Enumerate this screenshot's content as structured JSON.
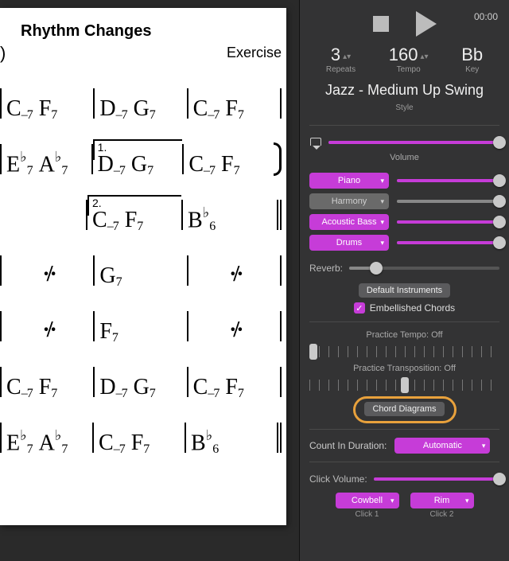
{
  "chart": {
    "title": "Rhythm Changes",
    "subtitle": "Exercise",
    "rows": [
      [
        [
          "C–7",
          "F7"
        ],
        [
          "D–7",
          "G7"
        ],
        [
          "C–7",
          "F7"
        ]
      ],
      [
        [
          "E♭7",
          "A♭7"
        ],
        [
          "D–7",
          "G7",
          "v1"
        ],
        [
          "C–7",
          "F7"
        ]
      ],
      [
        null,
        [
          "C–7",
          "F7",
          "v2"
        ],
        [
          "B♭6"
        ]
      ],
      [
        [
          "%"
        ],
        [
          "G7"
        ],
        [
          "%"
        ]
      ],
      [
        [
          "%"
        ],
        [
          "F7"
        ],
        [
          "%"
        ]
      ],
      [
        [
          "C–7",
          "F7"
        ],
        [
          "D–7",
          "G7"
        ],
        [
          "C–7",
          "F7"
        ]
      ],
      [
        [
          "E♭7",
          "A♭7"
        ],
        [
          "C–7",
          "F7"
        ],
        [
          "B♭6"
        ]
      ]
    ],
    "volta1": "1.",
    "volta2": "2."
  },
  "transport": {
    "time": "00:00",
    "repeats_value": "3",
    "repeats_label": "Repeats",
    "tempo_value": "160",
    "tempo_label": "Tempo",
    "key_value": "Bb",
    "key_label": "Key"
  },
  "style": {
    "name": "Jazz - Medium Up Swing",
    "label": "Style"
  },
  "mix": {
    "volume_label": "Volume",
    "instruments": [
      {
        "name": "Piano",
        "enabled": true,
        "level": 100
      },
      {
        "name": "Harmony",
        "enabled": false,
        "level": 100
      },
      {
        "name": "Acoustic Bass",
        "enabled": true,
        "level": 100
      },
      {
        "name": "Drums",
        "enabled": true,
        "level": 100
      }
    ],
    "reverb_label": "Reverb:",
    "reverb_level": 18,
    "default_instruments": "Default Instruments",
    "embellished_label": "Embellished Chords",
    "embellished_checked": true
  },
  "practice": {
    "tempo_label": "Practice Tempo: Off",
    "transposition_label": "Practice Transposition: Off",
    "chord_diagrams": "Chord Diagrams"
  },
  "countin": {
    "label": "Count In Duration:",
    "value": "Automatic"
  },
  "click": {
    "volume_label": "Click Volume:",
    "volume_level": 100,
    "click1_value": "Cowbell",
    "click1_label": "Click 1",
    "click2_value": "Rim",
    "click2_label": "Click 2"
  }
}
